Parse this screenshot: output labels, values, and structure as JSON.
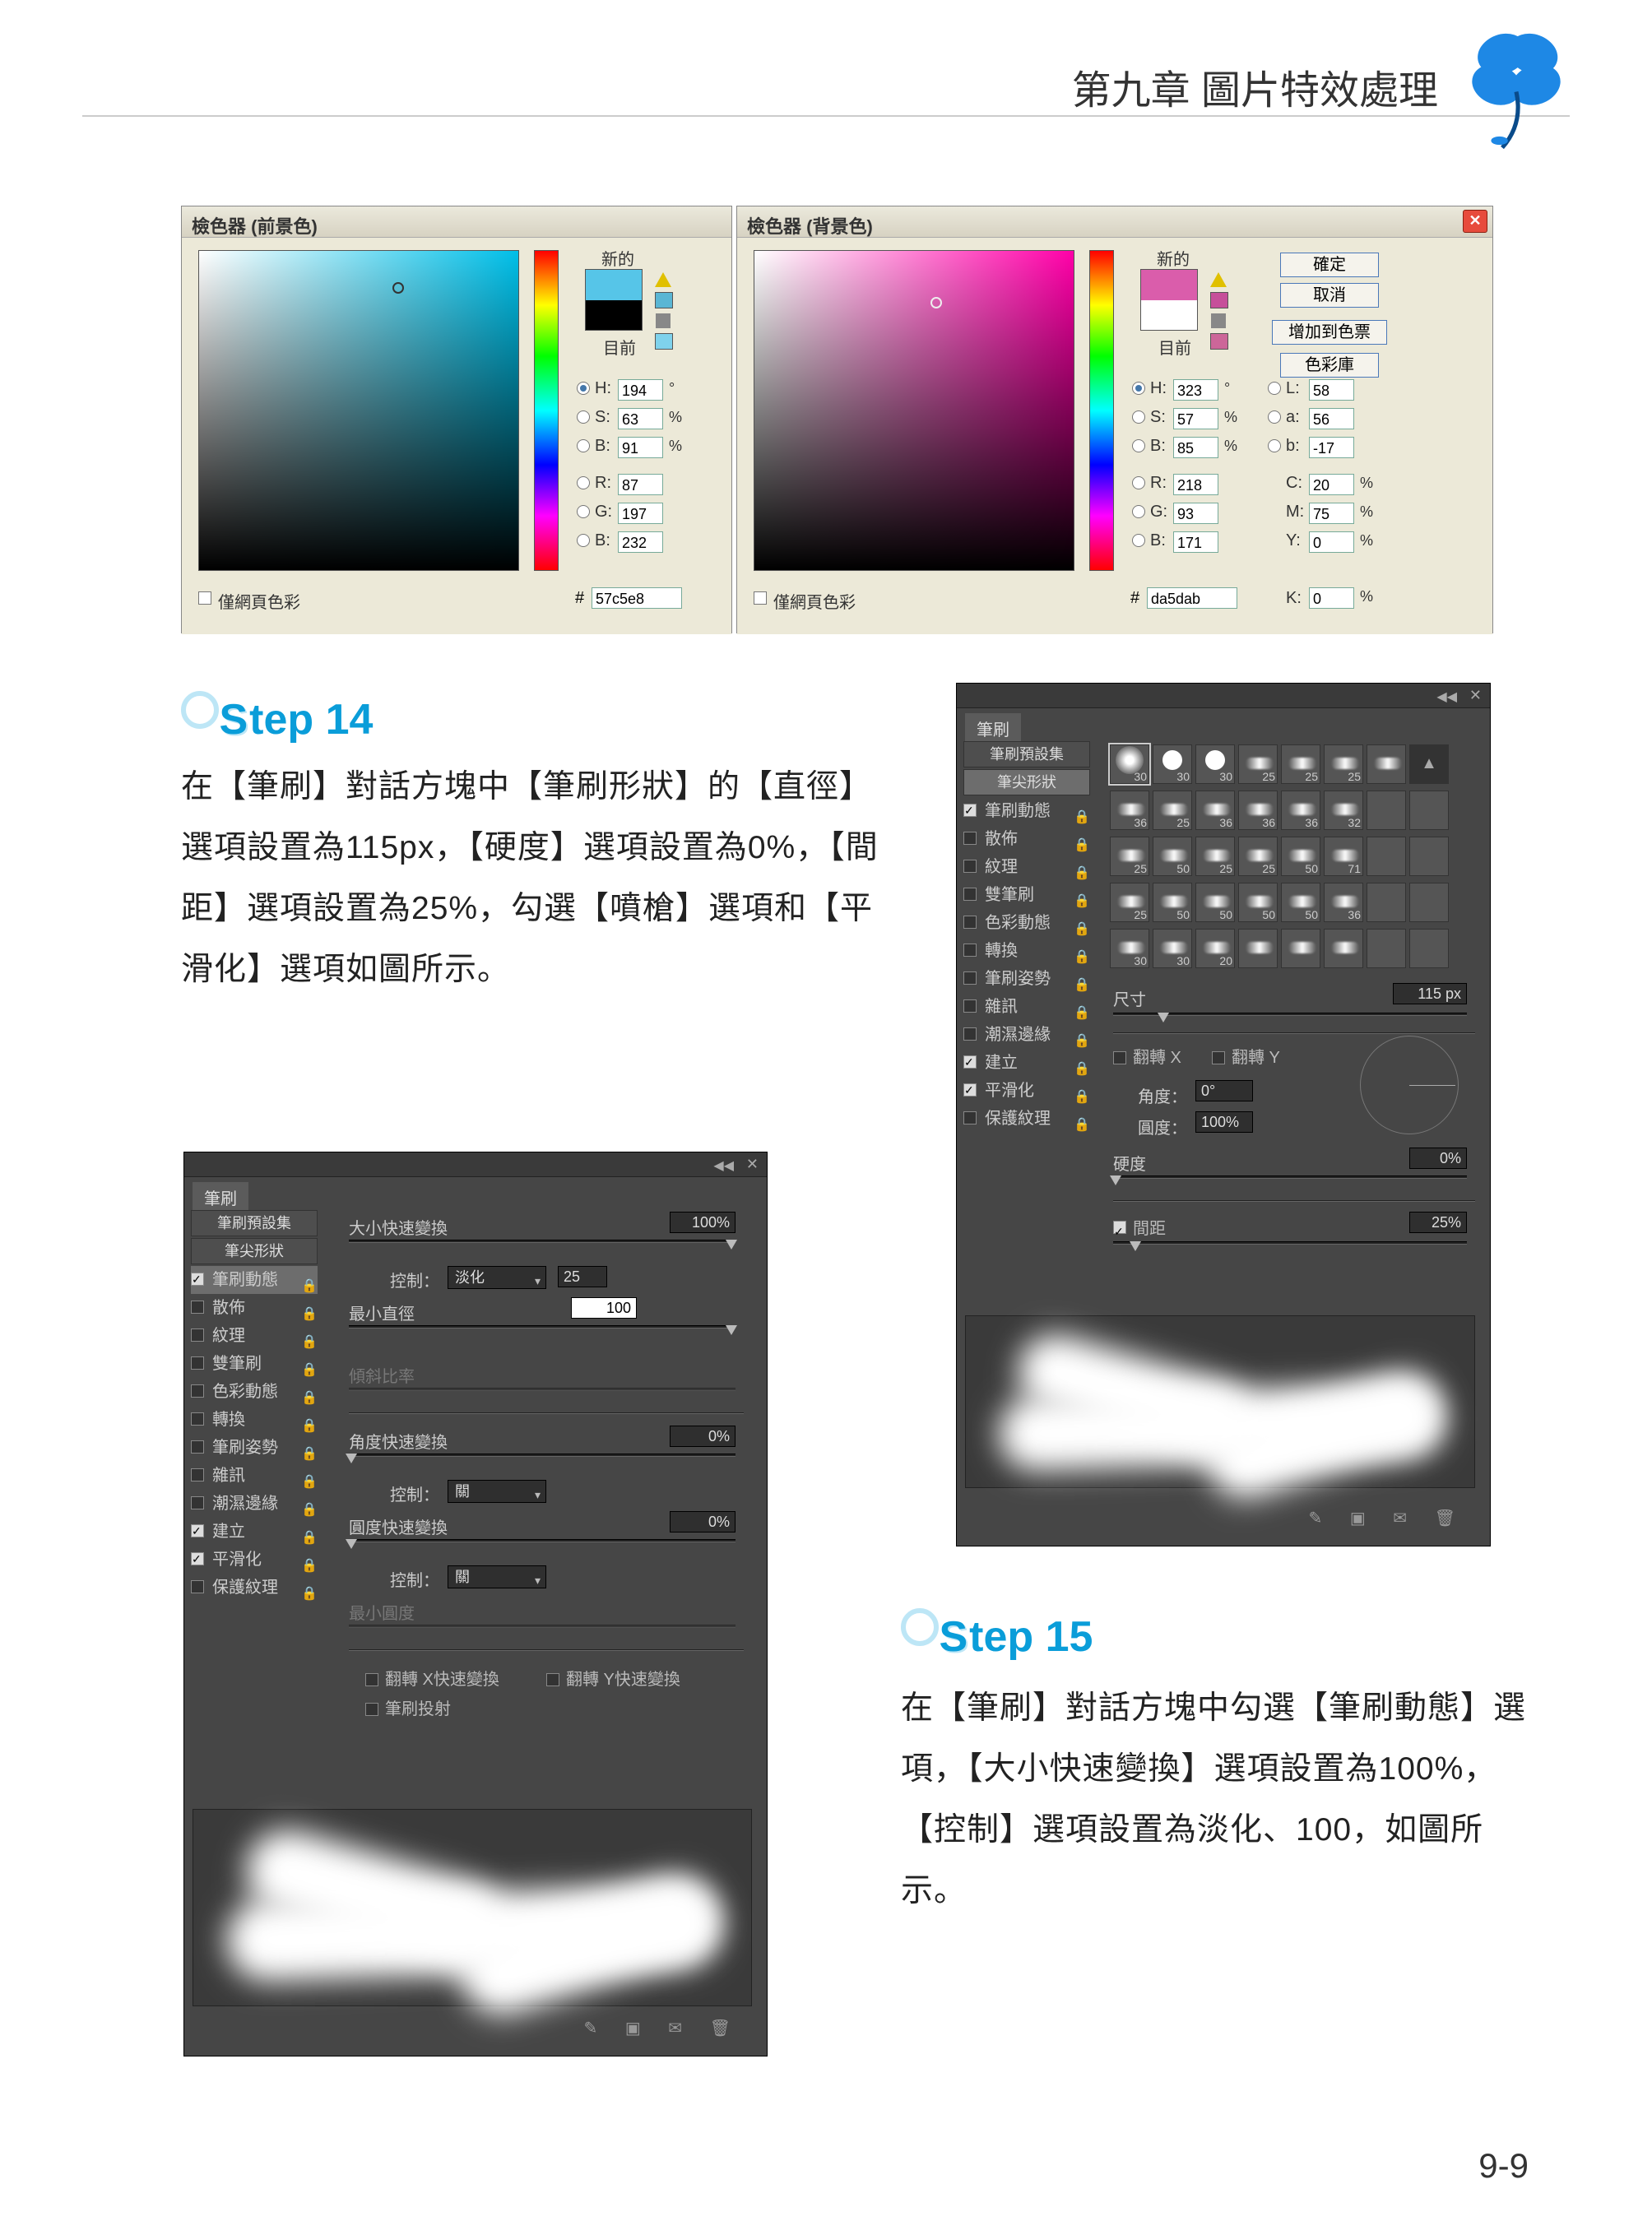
{
  "header": {
    "chapter_title": "第九章 圖片特效處理",
    "page_number": "9-9"
  },
  "color_pickers": {
    "fg": {
      "title": "檢色器 (前景色)",
      "new_label": "新的",
      "current_label": "目前",
      "web_only": "僅網頁色彩",
      "hex_prefix": "#",
      "hex": "57c5e8",
      "h": "194",
      "h_unit": "°",
      "s": "63",
      "s_unit": "%",
      "b": "91",
      "b_unit": "%",
      "r": "87",
      "g": "197",
      "b2": "232",
      "swatch_new": "#56c5e8",
      "swatch_cur": "#000000",
      "mini_swatch": "#7fd2ec"
    },
    "bg": {
      "title": "檢色器 (背景色)",
      "new_label": "新的",
      "current_label": "目前",
      "web_only": "僅網頁色彩",
      "hex_prefix": "#",
      "hex": "da5dab",
      "h": "323",
      "h_unit": "°",
      "s": "57",
      "s_unit": "%",
      "b": "85",
      "b_unit": "%",
      "r": "218",
      "g": "93",
      "b2": "171",
      "l_lab": "L:",
      "l": "58",
      "a_lab": "a:",
      "a": "56",
      "blab_lab": "b:",
      "blab": "-17",
      "c_lab": "C:",
      "c": "20",
      "c_unit": "%",
      "m_lab": "M:",
      "m": "75",
      "m_unit": "%",
      "y_lab": "Y:",
      "y": "0",
      "y_unit": "%",
      "k_lab": "K:",
      "k": "0",
      "k_unit": "%",
      "btn_ok": "確定",
      "btn_cancel": "取消",
      "btn_add": "增加到色票",
      "btn_lib": "色彩庫",
      "swatch_new": "#da5dab",
      "swatch_cur": "#ffffff",
      "mini_swatch": "#cc6699"
    }
  },
  "step14": {
    "heading_letter": "S",
    "heading_rest": "tep 14",
    "body": "在【筆刷】對話方塊中【筆刷形狀】的【直徑】選項設置為115px，【硬度】選項設置為0%，【間距】選項設置為25%，勾選【噴槍】選項和【平滑化】選項如圖所示。"
  },
  "brush_panel_a": {
    "tab": "筆刷",
    "presets_btn": "筆刷預設集",
    "tip_shape_btn": "筆尖形狀",
    "options": [
      {
        "label": "筆刷動態",
        "checked": true,
        "locked": true
      },
      {
        "label": "散佈",
        "checked": false,
        "locked": true
      },
      {
        "label": "紋理",
        "checked": false,
        "locked": true
      },
      {
        "label": "雙筆刷",
        "checked": false,
        "locked": true
      },
      {
        "label": "色彩動態",
        "checked": false,
        "locked": true
      },
      {
        "label": "轉換",
        "checked": false,
        "locked": true
      },
      {
        "label": "筆刷姿勢",
        "checked": false,
        "locked": true
      },
      {
        "label": "雜訊",
        "checked": false,
        "locked": true
      },
      {
        "label": "潮濕邊緣",
        "checked": false,
        "locked": true
      },
      {
        "label": "建立",
        "checked": true,
        "locked": true
      },
      {
        "label": "平滑化",
        "checked": true,
        "locked": true
      },
      {
        "label": "保護紋理",
        "checked": false,
        "locked": true
      }
    ],
    "thumbs": [
      {
        "s": "30",
        "sel": true,
        "k": "soft"
      },
      {
        "s": "30",
        "k": "hard"
      },
      {
        "s": "30",
        "k": "hard"
      },
      {
        "s": "25",
        "k": "sm"
      },
      {
        "s": "25",
        "k": "sm"
      },
      {
        "s": "25",
        "k": "sm"
      },
      {
        "s": "",
        "k": "sm"
      },
      {
        "s": "",
        "k": "tri"
      },
      {
        "s": "36",
        "k": "sm"
      },
      {
        "s": "25",
        "k": "sm"
      },
      {
        "s": "36",
        "k": "sm"
      },
      {
        "s": "36",
        "k": "sm"
      },
      {
        "s": "36",
        "k": "sm"
      },
      {
        "s": "32",
        "k": "sm"
      },
      {
        "s": "",
        "k": ""
      },
      {
        "s": "",
        "k": ""
      },
      {
        "s": "25",
        "k": "sm"
      },
      {
        "s": "50",
        "k": "sm"
      },
      {
        "s": "25",
        "k": "sm"
      },
      {
        "s": "25",
        "k": "sm"
      },
      {
        "s": "50",
        "k": "sm"
      },
      {
        "s": "71",
        "k": "sm"
      },
      {
        "s": "",
        "k": ""
      },
      {
        "s": "",
        "k": ""
      },
      {
        "s": "25",
        "k": "sm"
      },
      {
        "s": "50",
        "k": "sm"
      },
      {
        "s": "50",
        "k": "sm"
      },
      {
        "s": "50",
        "k": "sm"
      },
      {
        "s": "50",
        "k": "sm"
      },
      {
        "s": "36",
        "k": "sm"
      },
      {
        "s": "",
        "k": ""
      },
      {
        "s": "",
        "k": ""
      },
      {
        "s": "30",
        "k": "sm"
      },
      {
        "s": "30",
        "k": "sm"
      },
      {
        "s": "20",
        "k": "sm"
      },
      {
        "s": "",
        "k": "sm"
      },
      {
        "s": "",
        "k": "sm"
      },
      {
        "s": "",
        "k": "sm"
      },
      {
        "s": "",
        "k": ""
      },
      {
        "s": "",
        "k": ""
      }
    ],
    "size_label": "尺寸",
    "size_value": "115 px",
    "flipx_label": "翻轉 X",
    "flipy_label": "翻轉 Y",
    "angle_label": "角度：",
    "angle_value": "0°",
    "round_label": "圓度：",
    "round_value": "100%",
    "hard_label": "硬度",
    "hard_value": "0%",
    "spacing_chk": "間距",
    "spacing_value": "25%"
  },
  "step15": {
    "heading_letter": "S",
    "heading_rest": "tep 15",
    "body": "在【筆刷】對話方塊中勾選【筆刷動態】選項，【大小快速變換】選項設置為100%，【控制】選項設置為淡化、100，如圖所示。"
  },
  "brush_panel_b": {
    "tab": "筆刷",
    "presets_btn": "筆刷預設集",
    "tip_shape_btn": "筆尖形狀",
    "options": [
      {
        "label": "筆刷動態",
        "checked": true,
        "locked": true
      },
      {
        "label": "散佈",
        "checked": false,
        "locked": true
      },
      {
        "label": "紋理",
        "checked": false,
        "locked": true
      },
      {
        "label": "雙筆刷",
        "checked": false,
        "locked": true
      },
      {
        "label": "色彩動態",
        "checked": false,
        "locked": true
      },
      {
        "label": "轉換",
        "checked": false,
        "locked": true
      },
      {
        "label": "筆刷姿勢",
        "checked": false,
        "locked": true
      },
      {
        "label": "雜訊",
        "checked": false,
        "locked": true
      },
      {
        "label": "潮濕邊緣",
        "checked": false,
        "locked": true
      },
      {
        "label": "建立",
        "checked": true,
        "locked": true
      },
      {
        "label": "平滑化",
        "checked": true,
        "locked": true
      },
      {
        "label": "保護紋理",
        "checked": false,
        "locked": true
      }
    ],
    "size_jitter_label": "大小快速變換",
    "size_jitter_value": "100%",
    "control_label": "控制：",
    "control_value": "淡化",
    "control_steps": "25",
    "min_diam_label": "最小直徑",
    "min_diam_value": "100",
    "tilt_label": "傾斜比率",
    "angle_jitter_label": "角度快速變換",
    "angle_jitter_value": "0%",
    "control_label2": "控制：",
    "control_value2": "關",
    "round_jitter_label": "圓度快速變換",
    "round_jitter_value": "0%",
    "control_label3": "控制：",
    "control_value3": "關",
    "min_round_label": "最小圓度",
    "flipx_jitter": "翻轉 X快速變換",
    "flipy_jitter": "翻轉 Y快速變換",
    "brush_proj": "筆刷投射"
  }
}
